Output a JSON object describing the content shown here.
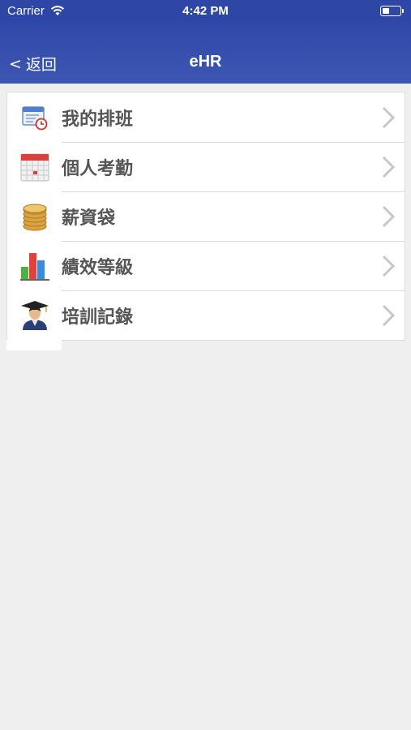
{
  "status_bar": {
    "carrier": "Carrier",
    "time": "4:42 PM",
    "battery_level": 0.35
  },
  "nav": {
    "back_label": "返回",
    "back_symbol": "<",
    "title": "eHR"
  },
  "colors": {
    "nav_bar": "#3049a8",
    "background": "#efefef"
  },
  "menu": {
    "items": [
      {
        "label": "我的排班",
        "icon": "schedule-icon"
      },
      {
        "label": "個人考勤",
        "icon": "calendar-icon"
      },
      {
        "label": "薪資袋",
        "icon": "coins-icon"
      },
      {
        "label": "績效等級",
        "icon": "bar-chart-icon"
      },
      {
        "label": "培訓記錄",
        "icon": "graduate-icon"
      }
    ]
  }
}
